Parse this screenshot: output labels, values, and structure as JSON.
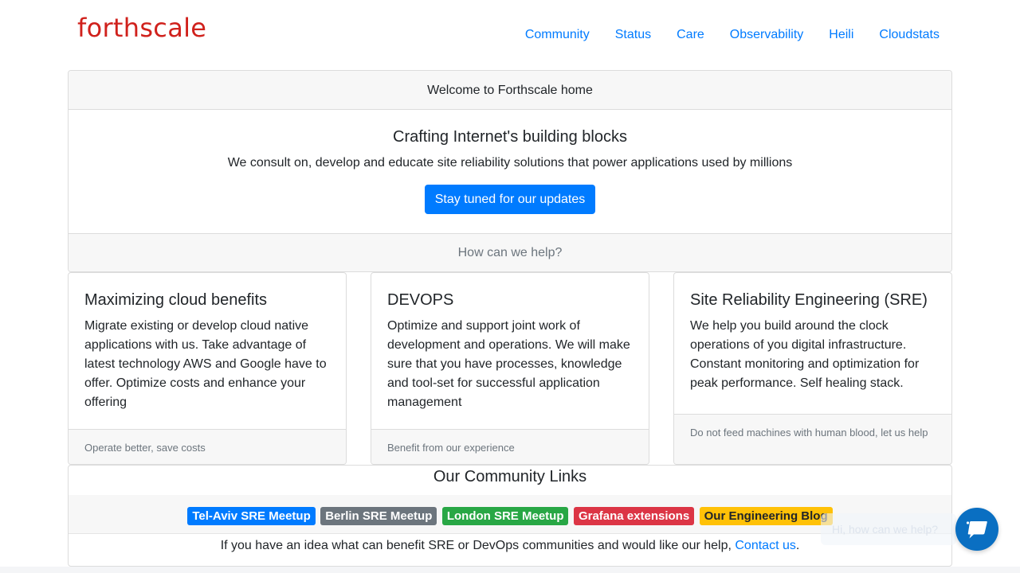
{
  "brand": {
    "logo_text": "forthscale",
    "logo_color": "#d0211c"
  },
  "nav": {
    "items": [
      {
        "label": "Community"
      },
      {
        "label": "Status"
      },
      {
        "label": "Care"
      },
      {
        "label": "Observability"
      },
      {
        "label": "Heili"
      },
      {
        "label": "Cloudstats"
      }
    ]
  },
  "welcome": {
    "header": "Welcome to Forthscale home",
    "title": "Crafting Internet's building blocks",
    "subtitle": "We consult on, develop and educate site reliability solutions that power applications used by millions",
    "cta_label": "Stay tuned for our updates",
    "help_prompt": "How can we help?"
  },
  "services": [
    {
      "title": "Maximizing cloud benefits",
      "body": "Migrate existing or develop cloud native applications with us. Take advantage of latest technology AWS and Google have to offer. Optimize costs and enhance your offering",
      "footer": "Operate better, save costs"
    },
    {
      "title": "DEVOPS",
      "body": "Optimize and support joint work of development and operations. We will make sure that you have processes, knowledge and tool-set for successful application management",
      "footer": "Benefit from our experience"
    },
    {
      "title": "Site Reliability Engineering (SRE)",
      "body": "We help you build around the clock operations of you digital infrastructure. Constant monitoring and optimization for peak performance. Self healing stack.",
      "footer": "Do not feed machines with human blood, let us help"
    }
  ],
  "community": {
    "title": "Our Community Links",
    "links": [
      {
        "label": "Tel-Aviv SRE Meetup",
        "color": "#007bff"
      },
      {
        "label": "Berlin SRE Meetup",
        "color": "#6c757d"
      },
      {
        "label": "London SRE Meetup",
        "color": "#28a745"
      },
      {
        "label": "Grafana extensions",
        "color": "#dc3545"
      },
      {
        "label": "Our Engineering Blog",
        "color": "#ffc107"
      }
    ],
    "idea_text": "If you have an idea what can benefit SRE or DevOps communities and would like our help, ",
    "contact_label": "Contact us",
    "idea_suffix": "."
  },
  "chat": {
    "hint": "Hi, how can we help?",
    "icon": "chat-bubble-icon",
    "color": "#0a6fc2"
  },
  "colors": {
    "link": "#007bff",
    "muted": "#6c757d",
    "panel_bg": "#f7f7f7"
  }
}
